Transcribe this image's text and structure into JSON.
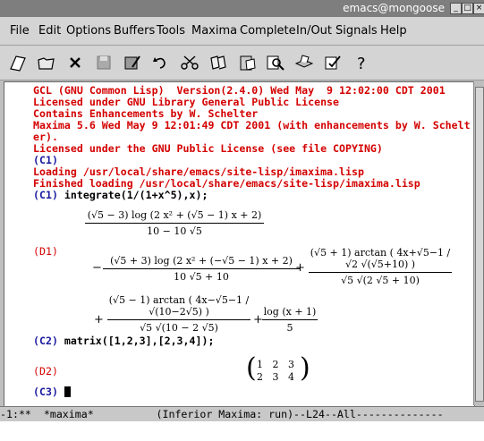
{
  "window": {
    "title": "emacs@mongoose",
    "buttons": [
      "_",
      "□",
      "×"
    ]
  },
  "menu": [
    "File",
    "Edit",
    "Options",
    "Buffers",
    "Tools",
    "Maxima",
    "Complete",
    "In/Out",
    "Signals",
    "Help"
  ],
  "toolbar_icons": [
    "open-file-icon",
    "open-directory-icon",
    "close-icon",
    "save-icon",
    "save-as-icon",
    "undo-icon",
    "cut-icon",
    "copy-icon",
    "paste-icon",
    "search-icon",
    "print-icon",
    "customize-icon",
    "help-icon"
  ],
  "colors": {
    "output_red": "#d40000",
    "input_blue": "#1a1aa0",
    "number_cyan": "#2a9ea0"
  },
  "buffer": {
    "header_lines": [
      "GCL (GNU Common Lisp)  Version(2.4.0) Wed May  9 12:02:00 CDT 2001",
      "Licensed under GNU Library General Public License",
      "Contains Enhancements by W. Schelter",
      "Maxima 5.6 Wed May 9 12:01:49 CDT 2001 (with enhancements by W. Schelt",
      "er).",
      "Licensed under the GNU Public License (see file COPYING)"
    ],
    "c1": "(C1)",
    "loading_lines": [
      "Loading /usr/local/share/emacs/site-lisp/imaxima.lisp",
      "Finished loading /usr/local/share/emacs/site-lisp/imaxima.lisp"
    ],
    "c1_label": "(C1)",
    "c1_input": "integrate(1/(1+x^5),x);",
    "d1_label": "(D1)",
    "c2_label": "(C2)",
    "c2_input": "matrix([1,2,3],[2,3,4]);",
    "d2_label": "(D2)",
    "matrix": [
      [
        "1",
        "2",
        "3"
      ],
      [
        "2",
        "3",
        "4"
      ]
    ],
    "c3_label": "(C3)"
  },
  "modeline": "-1:**  *maxima*          (Inferior Maxima: run)--L24--All--------------"
}
